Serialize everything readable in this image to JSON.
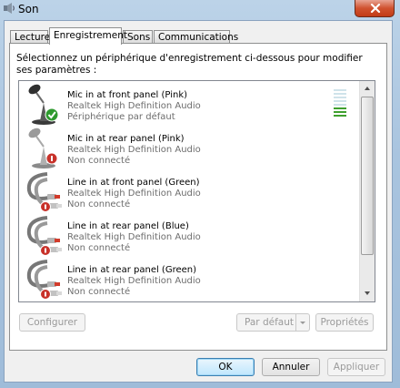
{
  "window": {
    "title": "Son",
    "icon": "speaker-icon"
  },
  "tabs": [
    {
      "label": "Lecture"
    },
    {
      "label": "Enregistrement",
      "active": true
    },
    {
      "label": "Sons"
    },
    {
      "label": "Communications"
    }
  ],
  "instructions": "Sélectionnez un périphérique d'enregistrement ci-dessous pour modifier ses paramètres :",
  "devices": [
    {
      "name": "Mic in at front panel (Pink)",
      "driver": "Realtek High Definition Audio",
      "status": "Périphérique par défaut",
      "icon": "microphone-icon",
      "badge": "default-check",
      "level_bars_active": 3,
      "level_bars_total": 8
    },
    {
      "name": "Mic in at rear panel (Pink)",
      "driver": "Realtek High Definition Audio",
      "status": "Non connecté",
      "icon": "microphone-icon",
      "badge": "disconnected"
    },
    {
      "name": "Line in at front panel (Green)",
      "driver": "Realtek High Definition Audio",
      "status": "Non connecté",
      "icon": "rca-cable-icon",
      "badge": "disconnected"
    },
    {
      "name": "Line in at rear panel (Blue)",
      "driver": "Realtek High Definition Audio",
      "status": "Non connecté",
      "icon": "rca-cable-icon",
      "badge": "disconnected"
    },
    {
      "name": "Line in at rear panel (Green)",
      "driver": "Realtek High Definition Audio",
      "status": "Non connecté",
      "icon": "rca-cable-icon",
      "badge": "disconnected"
    }
  ],
  "panel_buttons": {
    "configure": "Configurer",
    "set_default": "Par défaut",
    "properties": "Propriétés"
  },
  "dialog_buttons": {
    "ok": "OK",
    "cancel": "Annuler",
    "apply": "Appliquer"
  },
  "colors": {
    "level_active": "#3fa02e",
    "level_inactive": "#cfe3ea",
    "default_badge": "#2e9a2e",
    "disconnected_badge": "#c8322a"
  }
}
